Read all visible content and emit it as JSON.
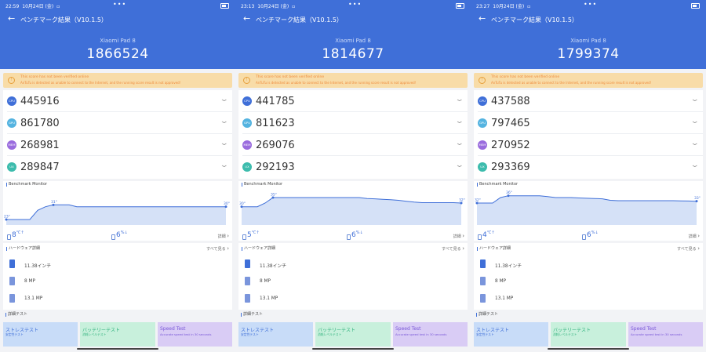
{
  "colors": {
    "header": "#3f6fd8",
    "cpu": "#3f6fd8",
    "gpu": "#54b3e0",
    "mem": "#9a6cde",
    "ux": "#3dbcad",
    "warning_bg": "#f8dca8",
    "warning_text": "#ef8a3a"
  },
  "screens": [
    {
      "status_time": "22:59",
      "status_date": "10月24日 (金)",
      "title": "ベンチマーク結果（V10.1.5）",
      "device": "Xiaomi Pad 8",
      "total": "1866524",
      "warning_line1": "This score has not been verified online",
      "warning_line2": "AnTuTu is detected as unable to connect to the Internet, and the running score result is not approved!",
      "scores": [
        {
          "label": "CPU",
          "value": "445916"
        },
        {
          "label": "GPU",
          "value": "861780"
        },
        {
          "label": "MEM",
          "value": "268981"
        },
        {
          "label": "UX",
          "value": "289847"
        }
      ],
      "monitor_title": "Benchmark Monitor",
      "temp_start": "23°",
      "temp_peak": "31°",
      "temp_end": "30°",
      "temp_curve": [
        23,
        23,
        23,
        23,
        28,
        30,
        31,
        31,
        31,
        30,
        30,
        30,
        30,
        30,
        30,
        30,
        30,
        30,
        30,
        30,
        30,
        30,
        30,
        30,
        30,
        30,
        30,
        30,
        30
      ],
      "temp_delta": "8",
      "temp_unit": "℃↑",
      "battery_delta": "6",
      "battery_unit": "%↓",
      "detail_label": "詳細",
      "hw_title": "ハードウェア詳細",
      "hw_more": "すべて見る",
      "hw_items": [
        "11.38インチ",
        "8 MP",
        "13.1 MP"
      ],
      "more_tests_title": "詳細テスト",
      "tiles": [
        {
          "title": "ストレステスト",
          "sub": "安定性テスト"
        },
        {
          "title": "バッテリーテスト",
          "sub": "消耗レベルテスト"
        },
        {
          "title": "Speed Test",
          "sub": "Accurate speed test in 30 seconds"
        }
      ]
    },
    {
      "status_time": "23:13",
      "status_date": "10月24日 (金)",
      "title": "ベンチマーク結果（V10.1.5）",
      "device": "Xiaomi Pad 8",
      "total": "1814677",
      "warning_line1": "This score has not been verified online",
      "warning_line2": "AnTuTu is detected as unable to connect to the Internet, and the running score result is not approved!",
      "scores": [
        {
          "label": "CPU",
          "value": "441785"
        },
        {
          "label": "GPU",
          "value": "811623"
        },
        {
          "label": "MEM",
          "value": "269076"
        },
        {
          "label": "UX",
          "value": "292193"
        }
      ],
      "monitor_title": "Benchmark Monitor",
      "temp_start": "30°",
      "temp_peak": "35°",
      "temp_end": "32°",
      "temp_curve": [
        30,
        30,
        30,
        32,
        35,
        35,
        35,
        35,
        35,
        35,
        35,
        35,
        35,
        35,
        35,
        35,
        34.5,
        34.3,
        34,
        33.8,
        33.5,
        33,
        32.5,
        32.2,
        32.2,
        32.2,
        32.2,
        32.2,
        32
      ],
      "temp_delta": "5",
      "temp_unit": "℃↑",
      "battery_delta": "6",
      "battery_unit": "%↓",
      "detail_label": "詳細",
      "hw_title": "ハードウェア詳細",
      "hw_more": "すべて見る",
      "hw_items": [
        "11.38インチ",
        "8 MP",
        "13.1 MP"
      ],
      "more_tests_title": "詳細テスト",
      "tiles": [
        {
          "title": "ストレステスト",
          "sub": "安定性テスト"
        },
        {
          "title": "バッテリーテスト",
          "sub": "消耗レベルテスト"
        },
        {
          "title": "Speed Test",
          "sub": "Accurate speed test in 30 seconds"
        }
      ]
    },
    {
      "status_time": "23:27",
      "status_date": "10月24日 (金)",
      "title": "ベンチマーク結果（V10.1.5）",
      "device": "Xiaomi Pad 8",
      "total": "1799374",
      "warning_line1": "This score has not been verified online",
      "warning_line2": "AnTuTu is detected as unable to connect to the Internet, and the running score result is not approved!",
      "scores": [
        {
          "label": "CPU",
          "value": "437588"
        },
        {
          "label": "GPU",
          "value": "797465"
        },
        {
          "label": "MEM",
          "value": "270952"
        },
        {
          "label": "UX",
          "value": "293369"
        }
      ],
      "monitor_title": "Benchmark Monitor",
      "temp_start": "32°",
      "temp_peak": "36°",
      "temp_end": "33°",
      "temp_curve": [
        32,
        32,
        32,
        35,
        36,
        36,
        36,
        36,
        36,
        35.5,
        35,
        35,
        35,
        34.8,
        34.6,
        34.5,
        34.3,
        33.5,
        33.3,
        33.3,
        33.3,
        33.3,
        33.3,
        33.3,
        33.3,
        33.3,
        33.2,
        33.1,
        33
      ],
      "temp_delta": "4",
      "temp_unit": "℃↑",
      "battery_delta": "6",
      "battery_unit": "%↓",
      "detail_label": "詳細",
      "hw_title": "ハードウェア詳細",
      "hw_more": "すべて見る",
      "hw_items": [
        "11.38インチ",
        "8 MP",
        "13.1 MP"
      ],
      "more_tests_title": "詳細テスト",
      "tiles": [
        {
          "title": "ストレステスト",
          "sub": "安定性テスト"
        },
        {
          "title": "バッテリーテスト",
          "sub": "消耗レベルテスト"
        },
        {
          "title": "Speed Test",
          "sub": "Accurate speed test in 30 seconds"
        }
      ]
    }
  ]
}
